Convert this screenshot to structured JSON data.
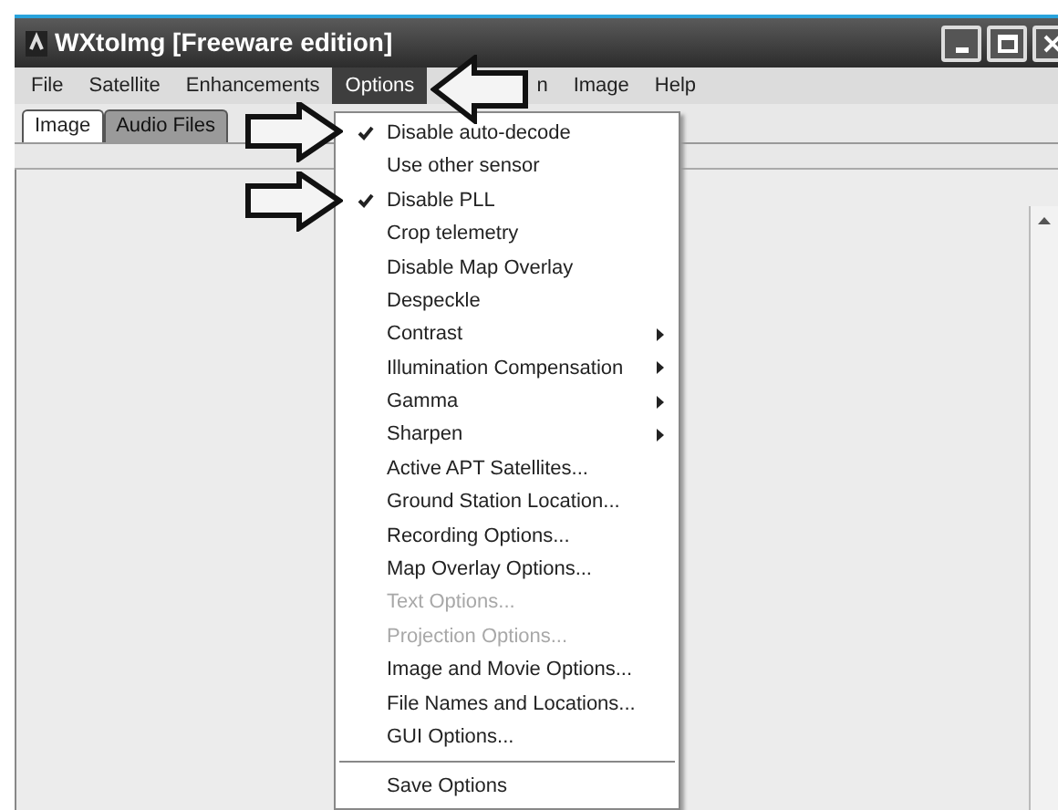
{
  "window": {
    "title": "WXtoImg [Freeware edition]"
  },
  "menu_bar": [
    {
      "label": "File",
      "selected": false
    },
    {
      "label": "Satellite",
      "selected": false
    },
    {
      "label": "Enhancements",
      "selected": false
    },
    {
      "label": "Options",
      "selected": true
    },
    {
      "label": "n",
      "selected": false
    },
    {
      "label": "Image",
      "selected": false
    },
    {
      "label": "Help",
      "selected": false
    }
  ],
  "tabs": [
    {
      "label": "Image",
      "selected": true
    },
    {
      "label": "Audio Files",
      "selected": false
    }
  ],
  "options_menu": {
    "items": [
      {
        "label": "Disable auto-decode",
        "checked": true,
        "disabled": false,
        "submenu": false
      },
      {
        "label": "Use other sensor",
        "checked": false,
        "disabled": false,
        "submenu": false
      },
      {
        "label": "Disable PLL",
        "checked": true,
        "disabled": false,
        "submenu": false
      },
      {
        "label": "Crop telemetry",
        "checked": false,
        "disabled": false,
        "submenu": false
      },
      {
        "label": "Disable Map Overlay",
        "checked": false,
        "disabled": false,
        "submenu": false
      },
      {
        "label": "Despeckle",
        "checked": false,
        "disabled": false,
        "submenu": false
      },
      {
        "label": "Contrast",
        "checked": false,
        "disabled": false,
        "submenu": true
      },
      {
        "label": "Illumination Compensation",
        "checked": false,
        "disabled": false,
        "submenu": true
      },
      {
        "label": "Gamma",
        "checked": false,
        "disabled": false,
        "submenu": true
      },
      {
        "label": "Sharpen",
        "checked": false,
        "disabled": false,
        "submenu": true
      },
      {
        "label": "Active APT Satellites...",
        "checked": false,
        "disabled": false,
        "submenu": false
      },
      {
        "label": "Ground Station Location...",
        "checked": false,
        "disabled": false,
        "submenu": false
      },
      {
        "label": "Recording Options...",
        "checked": false,
        "disabled": false,
        "submenu": false
      },
      {
        "label": "Map Overlay Options...",
        "checked": false,
        "disabled": false,
        "submenu": false
      },
      {
        "label": "Text Options...",
        "checked": false,
        "disabled": true,
        "submenu": false
      },
      {
        "label": "Projection Options...",
        "checked": false,
        "disabled": true,
        "submenu": false
      },
      {
        "label": "Image and Movie Options...",
        "checked": false,
        "disabled": false,
        "submenu": false
      },
      {
        "label": "File Names and Locations...",
        "checked": false,
        "disabled": false,
        "submenu": false
      },
      {
        "label": "GUI Options...",
        "checked": false,
        "disabled": false,
        "submenu": false
      }
    ],
    "footer_items": [
      {
        "label": "Save Options",
        "checked": false,
        "disabled": false,
        "submenu": false
      }
    ]
  }
}
